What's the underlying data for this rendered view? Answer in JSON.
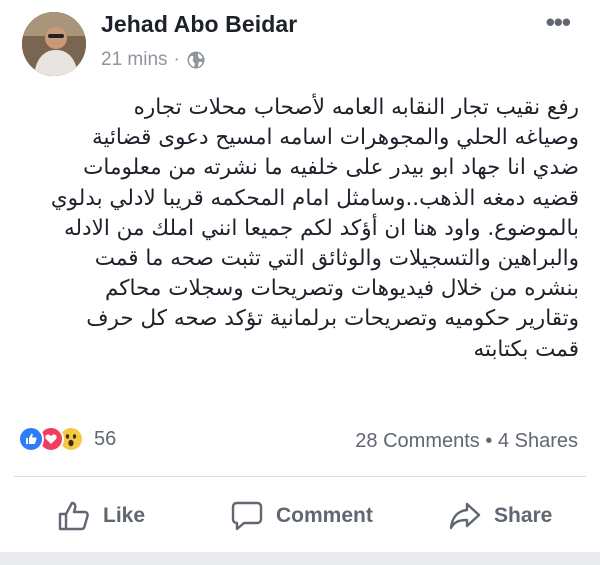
{
  "post": {
    "author": "Jehad Abo Beidar",
    "time": "21 mins",
    "separator": "·",
    "more_label": "•••",
    "body": "رفع نقيب تجار النقابه العامه لأصحاب محلات تجاره\nوصياغه الحلي والمجوهرات اسامه امسيح دعوى قضائية\nضدي انا جهاد ابو بيدر على خلفيه ما نشرته من معلومات\nقضيه دمغه الذهب..وسامثل امام المحكمه قريبا لادلي بدلوي\nبالموضوع. واود هنا ان أؤكد لكم جميعا انني املك من الادله\nوالبراهين والتسجيلات والوثائق التي تثبت صحه ما قمت\nبنشره من خلال فيديوهات وتصريحات وسجلات محاكم\nوتقارير حكوميه وتصريحات برلمانية تؤكد صحه كل حرف\nقمت بكتابته"
  },
  "reactions": {
    "icons": [
      "like-reaction",
      "love-reaction",
      "wow-reaction"
    ],
    "count": "56"
  },
  "stats": {
    "comments": "28 Comments",
    "dot": "•",
    "shares": "4 Shares"
  },
  "actions": {
    "like": "Like",
    "comment": "Comment",
    "share": "Share"
  },
  "colors": {
    "like": "#2f7df6",
    "love": "#f23e5c",
    "wow": "#f7c842",
    "muted": "#606770"
  }
}
